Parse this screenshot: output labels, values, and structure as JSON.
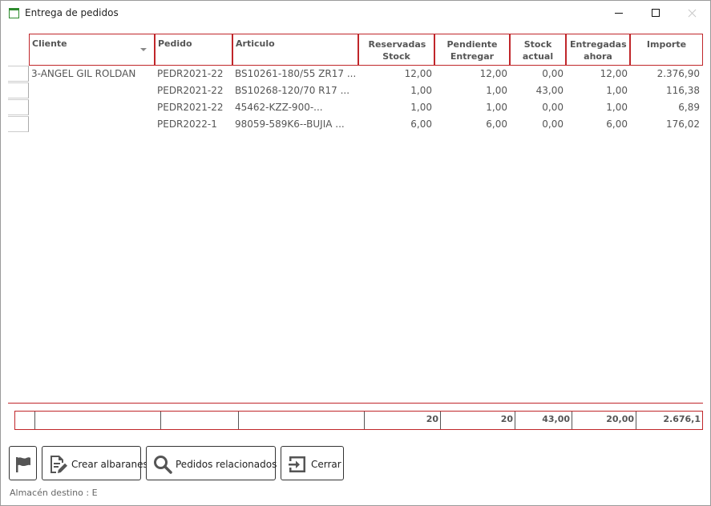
{
  "window": {
    "title": "Entrega de pedidos"
  },
  "grid": {
    "columns": [
      "Cliente",
      "Pedido",
      "Articulo",
      "Reservadas Stock",
      "Pendiente Entregar",
      "Stock actual",
      "Entregadas ahora",
      "Importe"
    ],
    "rows": [
      {
        "cliente": "3-ANGEL GIL ROLDAN",
        "pedido": "PEDR2021-22",
        "articulo": "BS10261-180/55 ZR17 ...",
        "reservadas": "12,00",
        "pendiente": "12,00",
        "stock": "0,00",
        "entregadas": "12,00",
        "importe": "2.376,90"
      },
      {
        "cliente": "",
        "pedido": "PEDR2021-22",
        "articulo": "BS10268-120/70 R17 ...",
        "reservadas": "1,00",
        "pendiente": "1,00",
        "stock": "43,00",
        "entregadas": "1,00",
        "importe": "116,38"
      },
      {
        "cliente": "",
        "pedido": "PEDR2021-22",
        "articulo": "45462-KZZ-900-...",
        "reservadas": "1,00",
        "pendiente": "1,00",
        "stock": "0,00",
        "entregadas": "1,00",
        "importe": "6,89"
      },
      {
        "cliente": "",
        "pedido": "PEDR2022-1",
        "articulo": "98059-589K6--BUJIA ...",
        "reservadas": "6,00",
        "pendiente": "6,00",
        "stock": "0,00",
        "entregadas": "6,00",
        "importe": "176,02"
      }
    ]
  },
  "totals": {
    "reservadas": "20",
    "pendiente": "20",
    "stock": "43,00",
    "entregadas": "20,00",
    "importe": "2.676,1"
  },
  "buttons": {
    "flag_icon": "flag-icon",
    "crear_albaranes": "Crear albaranes",
    "pedidos_relacionados": "Pedidos relacionados",
    "cerrar": "Cerrar"
  },
  "footer": {
    "almacen": "Almacén destino : E"
  },
  "colors": {
    "accent_red": "#c0262a",
    "icon_gray": "#555555"
  }
}
